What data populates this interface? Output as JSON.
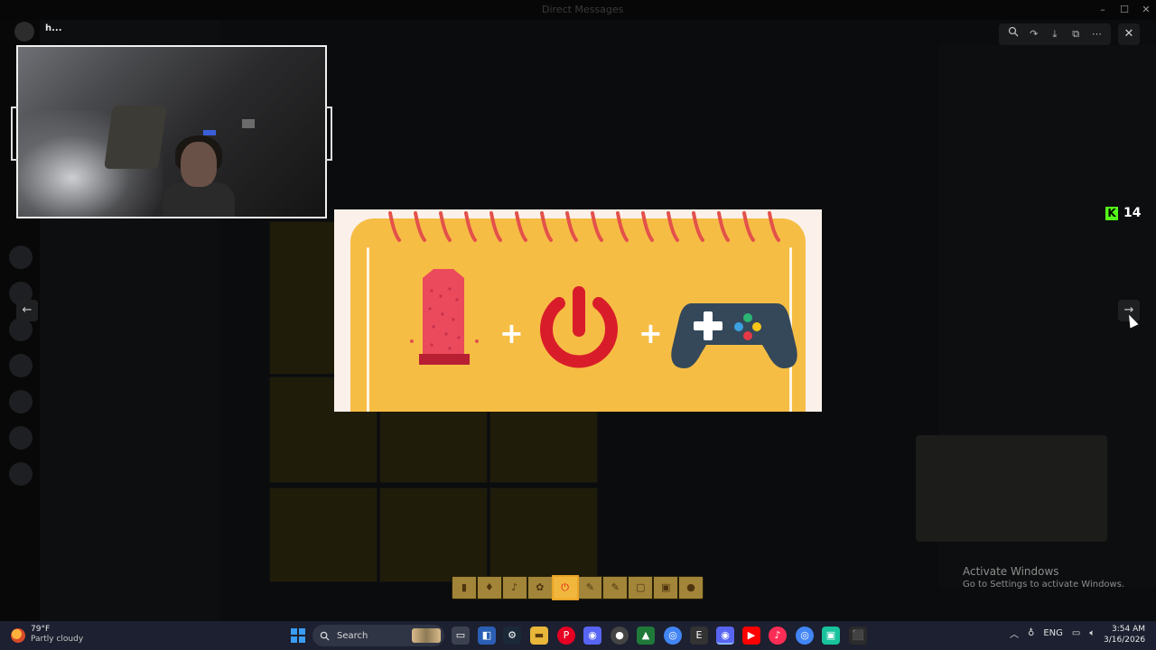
{
  "window": {
    "title": "Direct Messages"
  },
  "webcam": {
    "user_name": "h..."
  },
  "viewer": {
    "zoom_icon": "zoom-in-icon",
    "forward_icon": "forward-icon",
    "download_icon": "download-icon",
    "open_icon": "open-external-icon",
    "more_icon": "more-icon",
    "close_icon": "close-icon",
    "prev_arrow": "←",
    "next_arrow": "→"
  },
  "kick": {
    "count": "14",
    "logo_letter": "K",
    "logo_color": "#53fc18"
  },
  "main_image": {
    "items": [
      "sanding-block-icon",
      "power-icon",
      "gamepad-icon"
    ],
    "plus": "+",
    "accent": "#f6bd45",
    "red": "#d91c2a",
    "pad": "#34485a"
  },
  "thumbnails": {
    "count": 10,
    "active_index": 4
  },
  "activate_windows": {
    "title": "Activate Windows",
    "subtitle": "Go to Settings to activate Windows."
  },
  "taskbar": {
    "weather_temp": "79°F",
    "weather_desc": "Partly cloudy",
    "search_label": "Search",
    "lang": "ENG",
    "time": "3:54 AM",
    "date": "3/16/2026"
  }
}
